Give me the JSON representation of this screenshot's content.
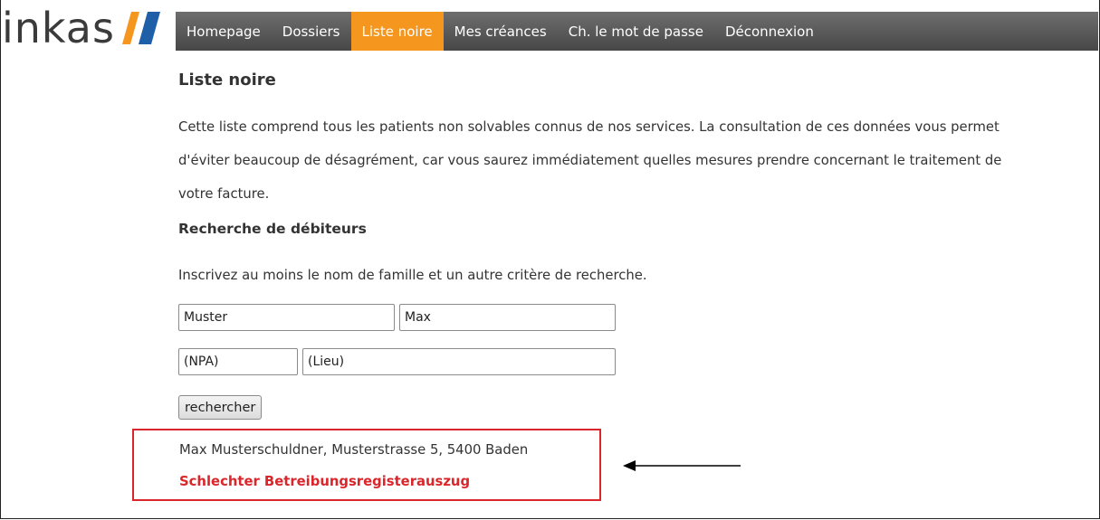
{
  "brand": {
    "logo_text": "inkas",
    "colors": {
      "slash_orange": "#f5961e",
      "slash_blue": "#1f5fa8"
    }
  },
  "nav": {
    "items": [
      {
        "label": "Homepage",
        "active": false
      },
      {
        "label": "Dossiers",
        "active": false
      },
      {
        "label": "Liste noire",
        "active": true
      },
      {
        "label": "Mes créances",
        "active": false
      },
      {
        "label": "Ch. le mot de passe",
        "active": false
      },
      {
        "label": "Déconnexion",
        "active": false
      }
    ],
    "active_color": "#f5961e"
  },
  "page": {
    "title": "Liste noire",
    "intro_lines": [
      "Cette liste comprend tous les patients non solvables connus de nos services. La consultation de ces données vous permet",
      "d'éviter beaucoup de désagrément, car vous saurez immédiatement quelles mesures prendre concernant le traitement de",
      "votre facture."
    ]
  },
  "search": {
    "section_title": "Recherche de débiteurs",
    "hint": "Inscrivez au moins le nom de famille et un autre critère de recherche.",
    "last_name": "Muster",
    "first_name": "Max",
    "zip": "(NPA)",
    "city": "(Lieu)",
    "button_label": "rechercher"
  },
  "result": {
    "address": "Max Musterschuldner, Musterstrasse 5, 5400 Baden",
    "status": "Schlechter Betreibungsregisterauszug",
    "status_color": "#d9262b"
  }
}
